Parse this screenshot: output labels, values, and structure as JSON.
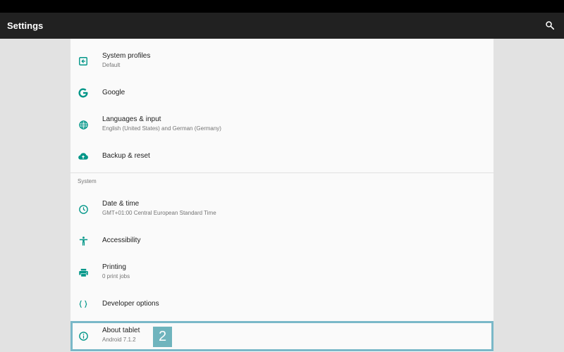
{
  "app_bar": {
    "title": "Settings"
  },
  "colors": {
    "accent": "#009688",
    "app_bar": "#212121",
    "highlight": "#7ab8c8"
  },
  "items": [
    {
      "title": "System profiles",
      "summary": "Default",
      "icon": "system-profiles-icon"
    },
    {
      "title": "Google",
      "icon": "google-icon"
    },
    {
      "title": "Languages & input",
      "summary": "English (United States) and German (Germany)",
      "icon": "globe-icon"
    },
    {
      "title": "Backup & reset",
      "icon": "cloud-upload-icon"
    }
  ],
  "system_section": {
    "header": "System",
    "items": [
      {
        "title": "Date & time",
        "summary": "GMT+01:00 Central European Standard Time",
        "icon": "clock-icon"
      },
      {
        "title": "Accessibility",
        "icon": "accessibility-icon"
      },
      {
        "title": "Printing",
        "summary": "0 print jobs",
        "icon": "printer-icon"
      },
      {
        "title": "Developer options",
        "icon": "braces-icon"
      },
      {
        "title": "About tablet",
        "summary": "Android 7.1.2",
        "icon": "info-icon"
      }
    ]
  },
  "step_badge": "2"
}
